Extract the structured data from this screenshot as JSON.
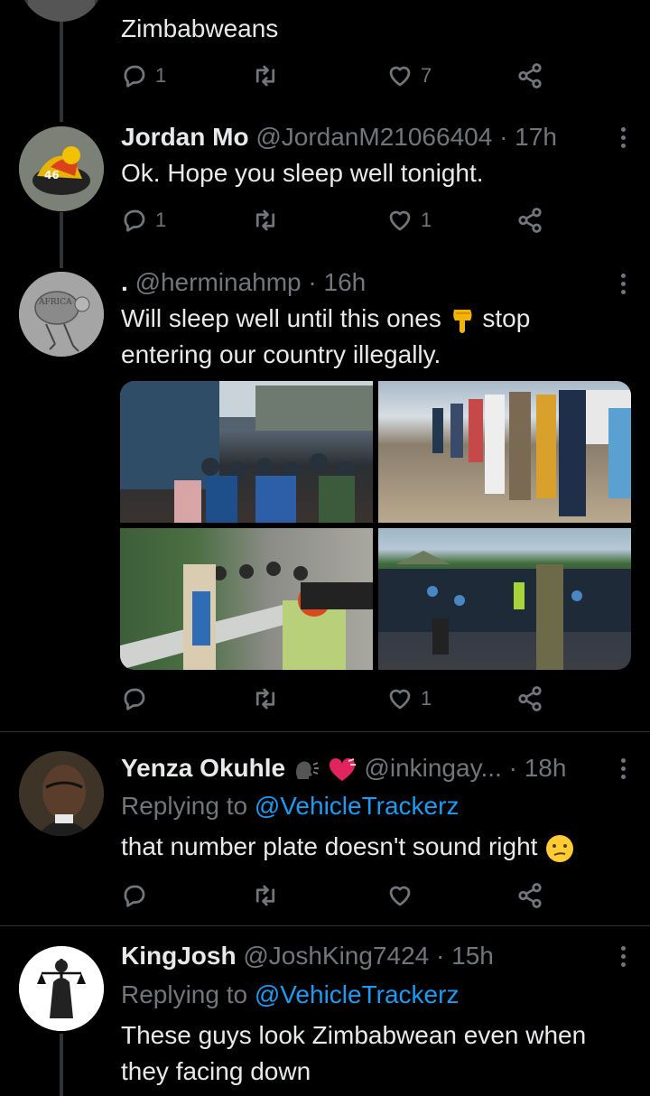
{
  "tweets": [
    {
      "text": "Zimbabweans",
      "replies": "1",
      "retweets": "",
      "likes": "7"
    },
    {
      "name": "Jordan Mo",
      "handle": "@JordanM21066404",
      "time": "· 17h",
      "text": "Ok. Hope you sleep well tonight.",
      "replies": "1",
      "likes": "1"
    },
    {
      "name": ".",
      "handle": "@herminahmp",
      "time": "· 16h",
      "text_part1": "Will sleep well until this ones",
      "text_part2": "stop",
      "text_line2": "entering our country illegally.",
      "likes": "1"
    },
    {
      "name": "Yenza Okuhle",
      "handle": "@inkingay...",
      "time": "· 18h",
      "reply_prefix": "Replying to",
      "reply_link": "@VehicleTrackerz",
      "text": "that number plate doesn't sound right"
    },
    {
      "name": "KingJosh",
      "handle": "@JoshKing7424",
      "time": "· 15h",
      "reply_prefix": "Replying to",
      "reply_link": "@VehicleTrackerz",
      "text_line1": "These guys look Zimbabwean even when",
      "text_line2": "they facing down"
    }
  ],
  "icons": {
    "reply": "reply-icon",
    "retweet": "retweet-icon",
    "like": "heart-icon",
    "share": "share-icon",
    "more": "more-icon"
  },
  "colors": {
    "background": "#000000",
    "text": "#e7e9ea",
    "muted": "#71767b",
    "link": "#1d9bf0",
    "divider": "#2f3336"
  }
}
